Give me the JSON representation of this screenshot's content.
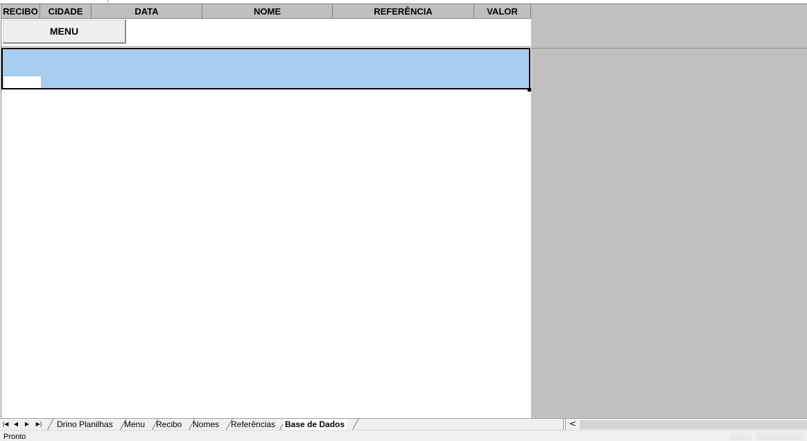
{
  "sheet": {
    "headers": [
      "RECIBO",
      "CIDADE",
      "DATA",
      "NOME",
      "REFERÊNCIA",
      "VALOR"
    ],
    "menu_button_label": "MENU"
  },
  "tabs": [
    {
      "label": "Drino Planilhas",
      "active": false
    },
    {
      "label": "Menu",
      "active": false
    },
    {
      "label": "Recibo",
      "active": false
    },
    {
      "label": "Nomes",
      "active": false
    },
    {
      "label": "Referências",
      "active": false
    },
    {
      "label": "Base de Dados",
      "active": true
    }
  ],
  "nav_icons": [
    "first-sheet-icon",
    "prev-sheet-icon",
    "next-sheet-icon",
    "last-sheet-icon"
  ],
  "status": {
    "text": "Pronto"
  },
  "colors": {
    "header_bg": "#bfbfbf",
    "selection": "#a6cdf0",
    "gray_panel": "#c0c0c0"
  }
}
